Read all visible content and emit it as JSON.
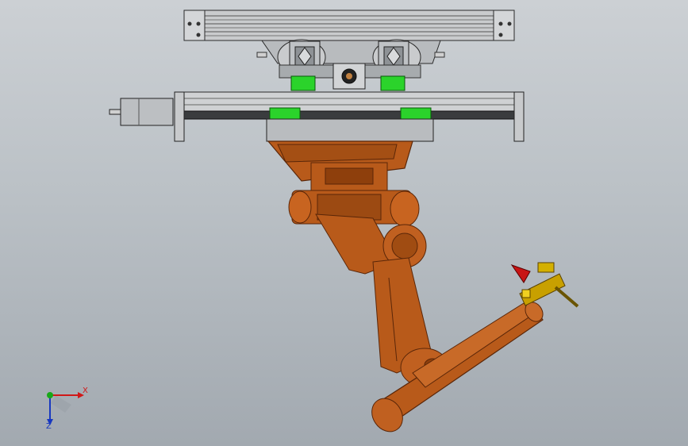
{
  "colors": {
    "background_top": "#ccd0d4",
    "background_bottom": "#a2a9b0",
    "robot_orange": "#b85a1a",
    "robot_dark": "#5a2608",
    "rail_grey": "#c4c6c8",
    "bearing_green": "#2bd32b",
    "torch_yellow": "#c8a000",
    "torch_tip_red": "#c81414",
    "axis_x": "#d01818",
    "axis_y": "#18a818",
    "axis_z": "#1838c0"
  },
  "view_triad": {
    "x_label": "X",
    "z_label": "Z"
  }
}
